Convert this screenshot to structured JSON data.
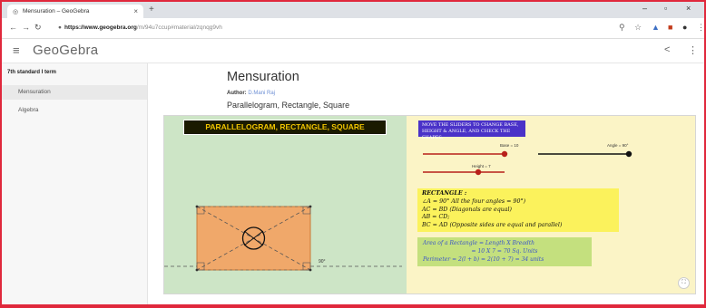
{
  "browser": {
    "tab_title": "Mensuration – GeoGebra",
    "url_host": "https://www.geogebra.org",
    "url_path": "/m/94u7ccup#material/zqnqg9vh"
  },
  "header": {
    "logo": "GeoGebra"
  },
  "sidebar": {
    "heading": "7th standard I term",
    "items": [
      {
        "label": "Mensuration"
      },
      {
        "label": "Algebra"
      }
    ]
  },
  "main": {
    "title": "Mensuration",
    "author_label": "Author:",
    "author_name": "D.Mani Raj",
    "subtitle": "Parallelogram, Rectangle, Square"
  },
  "applet": {
    "title": "PARALLELOGRAM, RECTANGLE, SQUARE",
    "instruction": "MOVE THE SLIDERS TO CHANGE BASE, HEIGHT & ANGLE, AND CHECK THE SHAPES.",
    "sliders": [
      {
        "label": "Base = 10",
        "value": 10
      },
      {
        "label": "Angle = 90°",
        "value": 90
      },
      {
        "label": "Height = 7",
        "value": 7
      }
    ],
    "rectangle_title": "RECTANGLE :",
    "properties": [
      "∠A = 90° All the four angles = 90°)",
      "AC = BD (Diagonals are equal)",
      "AB = CD;",
      "BC = AD (Opposite sides are equal and parallel)"
    ],
    "area_line": "Area of a Rectangle = Length X Breadth",
    "area_value": "= 10 X 7 = 70 Sq. Units",
    "perimeter_line": "Perimeter = 2(l + b) = 2(10 + 7) = 34 units",
    "angle_label": "90°",
    "zoom_icon": "fullscreen-icon"
  },
  "colors": {
    "frame": "#e0283c",
    "green_pane": "#cde5c6",
    "yellow_pane": "#fbf4c6",
    "title_text": "#f0c400",
    "instruction_bg": "#4a32c8",
    "shape_fill": "#f0a86a"
  }
}
